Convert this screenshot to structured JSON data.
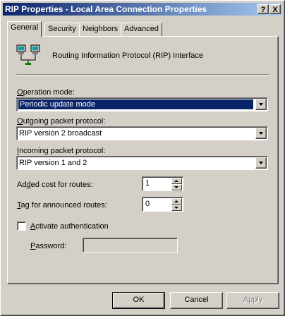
{
  "window": {
    "title": "RIP Properties - Local Area Connection Properties",
    "help_label": "?",
    "close_label": "X"
  },
  "tabs": [
    {
      "label": "General",
      "active": true
    },
    {
      "label": "Security",
      "active": false
    },
    {
      "label": "Neighbors",
      "active": false
    },
    {
      "label": "Advanced",
      "active": false
    }
  ],
  "general": {
    "header_text": "Routing Information Protocol (RIP) Interface",
    "header_icon": "network-computers-icon",
    "operation_mode": {
      "prefix": "",
      "accel": "O",
      "rest": "peration mode:",
      "value": "Periodic update mode"
    },
    "outgoing": {
      "prefix": "",
      "accel": "O",
      "rest": "utgoing packet protocol:",
      "value": "RIP version 2 broadcast"
    },
    "incoming": {
      "prefix": "",
      "accel": "I",
      "rest": "ncoming packet protocol:",
      "value": "RIP version 1 and 2"
    },
    "added_cost": {
      "prefix": "Ad",
      "accel": "d",
      "rest": "ed cost for routes:",
      "value": "1"
    },
    "tag": {
      "prefix": "",
      "accel": "T",
      "rest": "ag for announced routes:",
      "value": "0"
    },
    "auth": {
      "prefix": "",
      "accel": "A",
      "rest": "ctivate authentication",
      "checked": false
    },
    "password": {
      "prefix": "",
      "accel": "P",
      "rest": "assword:",
      "value": ""
    }
  },
  "buttons": {
    "ok": "OK",
    "cancel": "Cancel",
    "apply": "Apply"
  }
}
